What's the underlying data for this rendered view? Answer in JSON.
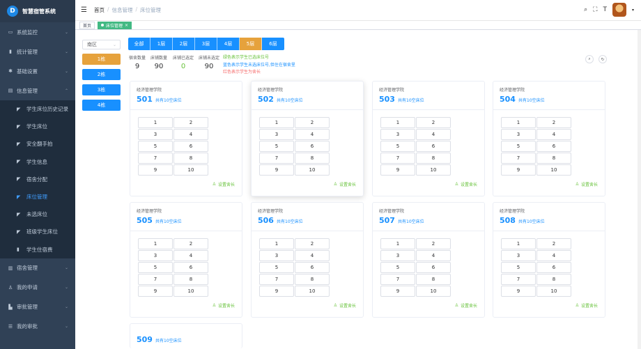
{
  "app": {
    "logo_letter": "D",
    "title": "智慧宿管系统"
  },
  "sidebar": {
    "items": [
      {
        "label": "系统监控",
        "icon": "monitor-icon",
        "glyph": "▭",
        "arrow": "⌄"
      },
      {
        "label": "统计管理",
        "icon": "chart-icon",
        "glyph": "▮",
        "arrow": "⌄"
      },
      {
        "label": "基础设置",
        "icon": "gear-icon",
        "glyph": "✱",
        "arrow": "⌄"
      },
      {
        "label": "信息管理",
        "icon": "document-icon",
        "glyph": "▤",
        "arrow": "⌃"
      }
    ],
    "subitems": [
      {
        "label": "学生床位历史记录",
        "icon": "send-icon",
        "glyph": "◤"
      },
      {
        "label": "学生床位",
        "icon": "send-icon",
        "glyph": "◤"
      },
      {
        "label": "安全翻手拍",
        "icon": "send-icon",
        "glyph": "◤"
      },
      {
        "label": "学生信息",
        "icon": "send-icon",
        "glyph": "◤"
      },
      {
        "label": "宿舍分配",
        "icon": "send-icon",
        "glyph": "◤"
      },
      {
        "label": "床位管理",
        "icon": "send-icon",
        "glyph": "◤",
        "active": true
      },
      {
        "label": "未选床位",
        "icon": "send-icon",
        "glyph": "◤"
      },
      {
        "label": "班级学生床位",
        "icon": "send-icon",
        "glyph": "◤"
      },
      {
        "label": "学生住宿费",
        "icon": "chart-icon",
        "glyph": "▮"
      }
    ],
    "bottom_items": [
      {
        "label": "宿舍管理",
        "icon": "building-icon",
        "glyph": "▥",
        "arrow": "⌄"
      },
      {
        "label": "我的申请",
        "icon": "user-icon",
        "glyph": "♙",
        "arrow": "⌄"
      },
      {
        "label": "审批管理",
        "icon": "stamp-icon",
        "glyph": "▙",
        "arrow": "⌄"
      },
      {
        "label": "我的审批",
        "icon": "list-icon",
        "glyph": "☰",
        "arrow": "⌄"
      }
    ]
  },
  "header": {
    "hamburger": "☰",
    "breadcrumb": [
      "首页",
      "信息管理",
      "床位管理"
    ],
    "sep": "/",
    "icons": {
      "search": "⌕",
      "fullscreen": "⛶",
      "font_size": "T",
      "caret": "▾"
    }
  },
  "tags": {
    "home": "首页",
    "active": "床位管理",
    "close": "×"
  },
  "zone": {
    "value": "南区",
    "chevron": "⌄"
  },
  "buildings": [
    "1栋",
    "2栋",
    "3栋",
    "4栋"
  ],
  "active_building": "1栋",
  "floors": [
    "全部",
    "1层",
    "2层",
    "3层",
    "4层",
    "5层",
    "6层"
  ],
  "active_floor": "5层",
  "stats": [
    {
      "label": "宿舍数量",
      "value": "9",
      "color": "default"
    },
    {
      "label": "床铺数量",
      "value": "90",
      "color": "default"
    },
    {
      "label": "床铺已选定",
      "value": "0",
      "color": "green"
    },
    {
      "label": "床铺未选定",
      "value": "90",
      "color": "default"
    }
  ],
  "legend": {
    "green": "绿色表示学生已选床位号",
    "blue": "蓝色表示学生未选床位号,但住在宿舍里",
    "red": "红色表示学生为舍长"
  },
  "tool_buttons": {
    "search": "⌕",
    "refresh": "↻"
  },
  "colors": {
    "primary": "#1890ff",
    "warning": "#e6a23c",
    "success": "#67c23a",
    "danger": "#f56c6c",
    "sidebar": "#304156"
  },
  "rooms": [
    {
      "college": "经济管理学院",
      "number": "501",
      "free": "共有10空床位",
      "beds": [
        "1",
        "2",
        "3",
        "4",
        "5",
        "6",
        "7",
        "8",
        "9",
        "10"
      ],
      "set_head": "设置舍长"
    },
    {
      "college": "经济管理学院",
      "number": "502",
      "free": "共有10空床位",
      "beds": [
        "1",
        "2",
        "3",
        "4",
        "5",
        "6",
        "7",
        "8",
        "9",
        "10"
      ],
      "set_head": "设置舍长"
    },
    {
      "college": "经济管理学院",
      "number": "503",
      "free": "共有10空床位",
      "beds": [
        "1",
        "2",
        "3",
        "4",
        "5",
        "6",
        "7",
        "8",
        "9",
        "10"
      ],
      "set_head": "设置舍长"
    },
    {
      "college": "经济管理学院",
      "number": "504",
      "free": "共有10空床位",
      "beds": [
        "1",
        "2",
        "3",
        "4",
        "5",
        "6",
        "7",
        "8",
        "9",
        "10"
      ],
      "set_head": "设置舍长"
    },
    {
      "college": "经济管理学院",
      "number": "505",
      "free": "共有10空床位",
      "beds": [
        "1",
        "2",
        "3",
        "4",
        "5",
        "6",
        "7",
        "8",
        "9",
        "10"
      ],
      "set_head": "设置舍长"
    },
    {
      "college": "经济管理学院",
      "number": "506",
      "free": "共有10空床位",
      "beds": [
        "1",
        "2",
        "3",
        "4",
        "5",
        "6",
        "7",
        "8",
        "9",
        "10"
      ],
      "set_head": "设置舍长"
    },
    {
      "college": "经济管理学院",
      "number": "507",
      "free": "共有10空床位",
      "beds": [
        "1",
        "2",
        "3",
        "4",
        "5",
        "6",
        "7",
        "8",
        "9",
        "10"
      ],
      "set_head": "设置舍长"
    },
    {
      "college": "经济管理学院",
      "number": "508",
      "free": "共有10空床位",
      "beds": [
        "1",
        "2",
        "3",
        "4",
        "5",
        "6",
        "7",
        "8",
        "9",
        "10"
      ],
      "set_head": "设置舍长"
    },
    {
      "college": "",
      "number": "509",
      "free": "共有10空床位",
      "beds": [],
      "set_head": ""
    }
  ]
}
